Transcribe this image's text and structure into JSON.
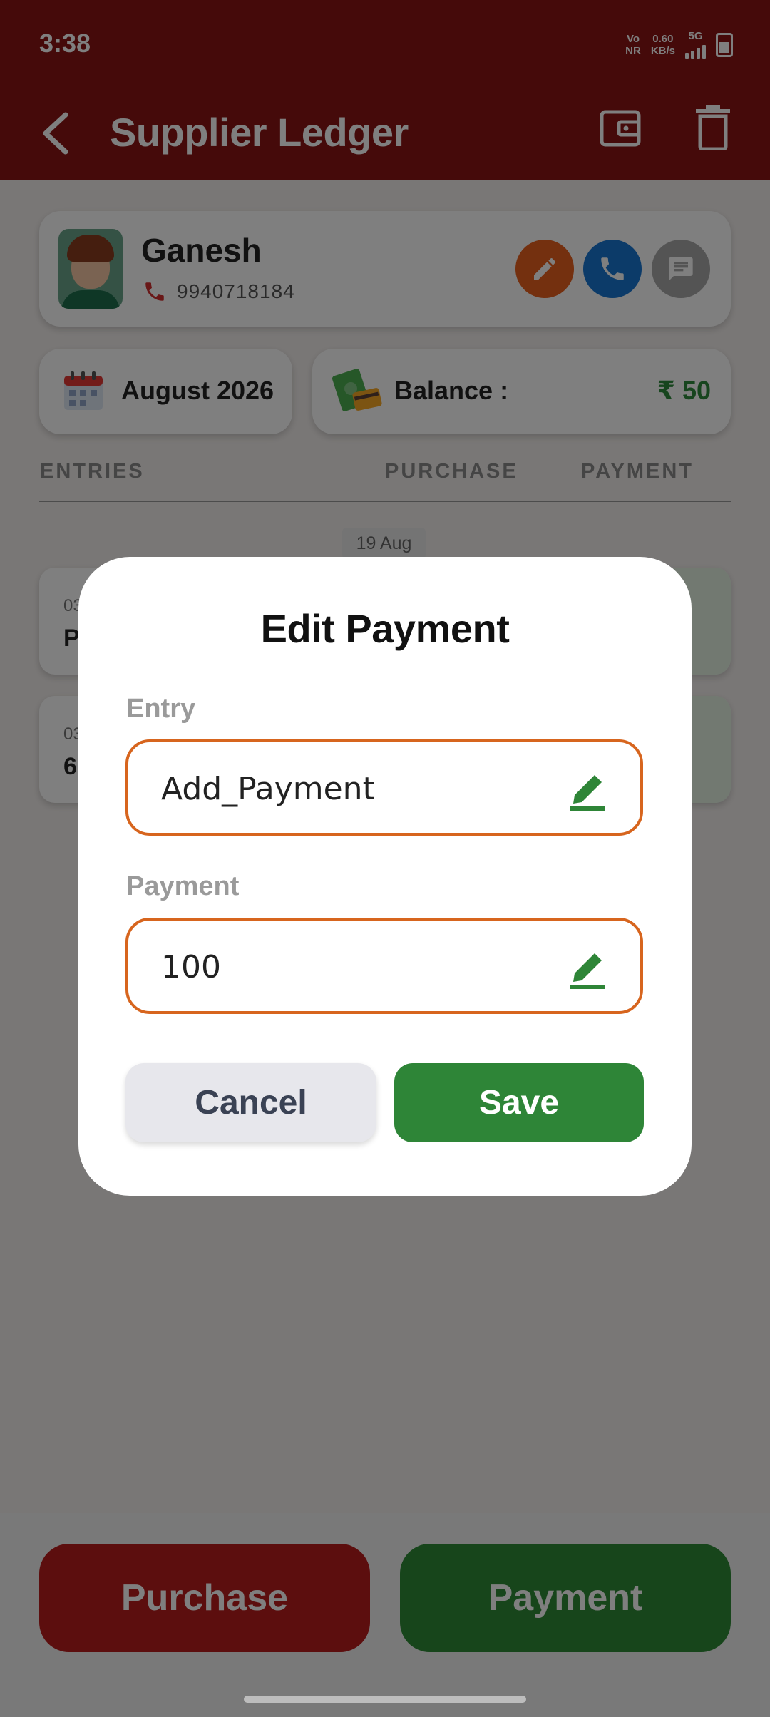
{
  "status_bar": {
    "time": "3:38",
    "network_top": "Vo",
    "network_bottom": "NR",
    "speed_top": "0.60",
    "speed_bottom": "KB/s",
    "signal_label": "5G"
  },
  "app_bar": {
    "title": "Supplier Ledger",
    "back_icon": "back-arrow-icon",
    "wallet_icon": "wallet-icon",
    "delete_icon": "trash-icon",
    "color": "#8b1414"
  },
  "contact": {
    "name": "Ganesh",
    "phone": "9940718184"
  },
  "summary": {
    "month": "August 2026",
    "balance_label": "Balance :",
    "balance_value": "₹ 50"
  },
  "columns": {
    "entries": "ENTRIES",
    "purchase": "PURCHASE",
    "payment": "PAYMENT"
  },
  "ledger": {
    "date_chip": "19 Aug",
    "rows": [
      {
        "small": "03",
        "main": "P"
      },
      {
        "small": "03",
        "main": "6"
      }
    ]
  },
  "bottom_actions": {
    "purchase": "Purchase",
    "payment": "Payment"
  },
  "dialog": {
    "title": "Edit Payment",
    "entry_label": "Entry",
    "entry_value": "Add_Payment",
    "payment_label": "Payment",
    "payment_value": "100",
    "cancel": "Cancel",
    "save": "Save",
    "accent_color": "#d7651e",
    "save_color": "#2e8537"
  }
}
